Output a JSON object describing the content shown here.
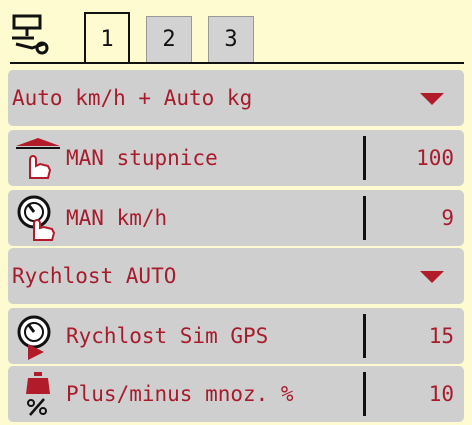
{
  "tabs": [
    {
      "label": "1",
      "active": true
    },
    {
      "label": "2",
      "active": false
    },
    {
      "label": "3",
      "active": false
    }
  ],
  "rows": [
    {
      "type": "dropdown",
      "label": "Auto km/h + Auto kg"
    },
    {
      "type": "value",
      "icon": "hand-scale-icon",
      "label": "MAN stupnice",
      "value": "100"
    },
    {
      "type": "value",
      "icon": "hand-speedometer-icon",
      "label": "MAN km/h",
      "value": "9"
    },
    {
      "type": "dropdown",
      "label": "Rychlost AUTO"
    },
    {
      "type": "value",
      "icon": "gps-speedometer-icon",
      "label": "Rychlost Sim GPS",
      "value": "15"
    },
    {
      "type": "value",
      "icon": "weight-percent-icon",
      "label": "Plus/minus mnoz. %",
      "value": "10"
    }
  ],
  "colors": {
    "background": "#fdfbcf",
    "row": "#cfcfcf",
    "text": "#a71c2c",
    "accent": "#b21c2a"
  }
}
